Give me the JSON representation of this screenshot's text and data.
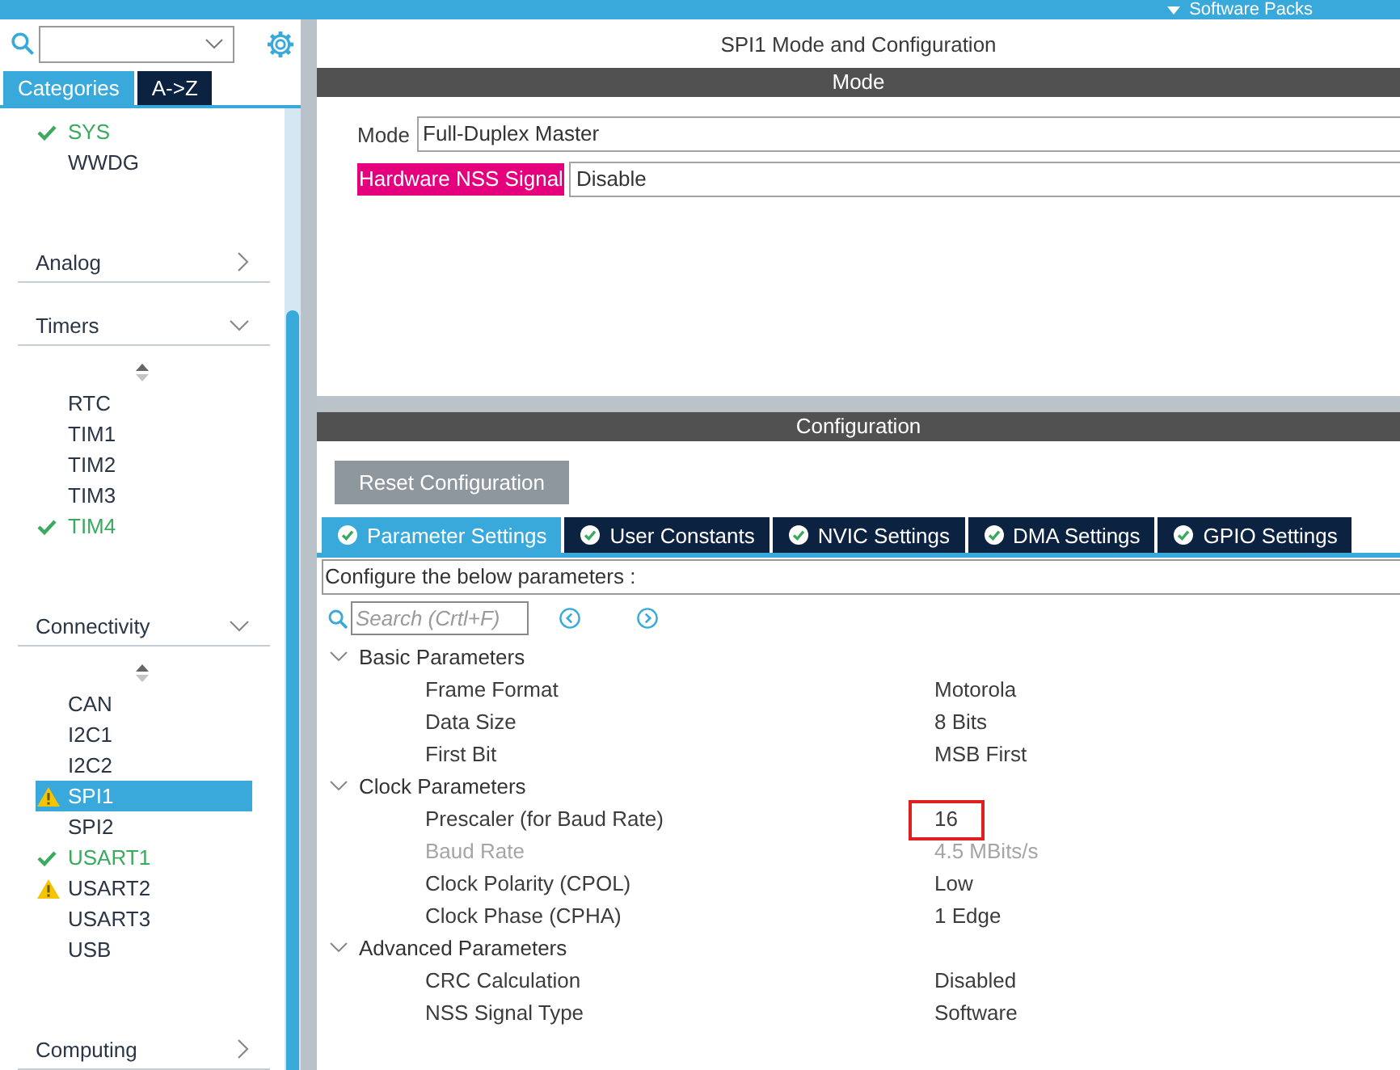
{
  "top_bar": {
    "menu_label": "Software Packs"
  },
  "sidebar": {
    "tabs": [
      {
        "label": "Categories",
        "selected": true
      },
      {
        "label": "A->Z",
        "selected": false
      }
    ],
    "leading_items": [
      {
        "label": "SYS",
        "configured": true,
        "warning": false,
        "selected": false
      },
      {
        "label": "WWDG",
        "configured": false,
        "warning": false,
        "selected": false
      }
    ],
    "categories": [
      {
        "name": "Analog",
        "expanded": false
      },
      {
        "name": "Timers",
        "expanded": true,
        "items": [
          {
            "label": "RTC",
            "configured": false,
            "warning": false,
            "selected": false
          },
          {
            "label": "TIM1",
            "configured": false,
            "warning": false,
            "selected": false
          },
          {
            "label": "TIM2",
            "configured": false,
            "warning": false,
            "selected": false
          },
          {
            "label": "TIM3",
            "configured": false,
            "warning": false,
            "selected": false
          },
          {
            "label": "TIM4",
            "configured": true,
            "warning": false,
            "selected": false
          }
        ]
      },
      {
        "name": "Connectivity",
        "expanded": true,
        "items": [
          {
            "label": "CAN",
            "configured": false,
            "warning": false,
            "selected": false
          },
          {
            "label": "I2C1",
            "configured": false,
            "warning": false,
            "selected": false
          },
          {
            "label": "I2C2",
            "configured": false,
            "warning": false,
            "selected": false
          },
          {
            "label": "SPI1",
            "configured": false,
            "warning": true,
            "selected": true
          },
          {
            "label": "SPI2",
            "configured": false,
            "warning": false,
            "selected": false
          },
          {
            "label": "USART1",
            "configured": true,
            "warning": false,
            "selected": false
          },
          {
            "label": "USART2",
            "configured": false,
            "warning": true,
            "selected": false
          },
          {
            "label": "USART3",
            "configured": false,
            "warning": false,
            "selected": false
          },
          {
            "label": "USB",
            "configured": false,
            "warning": false,
            "selected": false
          }
        ]
      },
      {
        "name": "Computing",
        "expanded": false
      }
    ]
  },
  "main": {
    "title": "SPI1 Mode and Configuration",
    "mode_section": {
      "header": "Mode",
      "fields": [
        {
          "label": "Mode",
          "value": "Full-Duplex Master",
          "highlighted": false
        },
        {
          "label": "Hardware NSS Signal",
          "value": "Disable",
          "highlighted": true
        }
      ]
    },
    "config_section": {
      "header": "Configuration",
      "reset_button": "Reset Configuration",
      "tabs": [
        {
          "label": "Parameter Settings",
          "selected": true
        },
        {
          "label": "User Constants",
          "selected": false
        },
        {
          "label": "NVIC Settings",
          "selected": false
        },
        {
          "label": "DMA Settings",
          "selected": false
        },
        {
          "label": "GPIO Settings",
          "selected": false
        }
      ],
      "hint": "Configure the below parameters :",
      "search": {
        "placeholder": "Search (Crtl+F)"
      },
      "parameter_groups": [
        {
          "name": "Basic Parameters",
          "expanded": true,
          "parameters": [
            {
              "label": "Frame Format",
              "value": "Motorola",
              "disabled": false,
              "framed": false
            },
            {
              "label": "Data Size",
              "value": "8 Bits",
              "disabled": false,
              "framed": false
            },
            {
              "label": "First Bit",
              "value": "MSB First",
              "disabled": false,
              "framed": false
            }
          ]
        },
        {
          "name": "Clock Parameters",
          "expanded": true,
          "parameters": [
            {
              "label": "Prescaler (for Baud Rate)",
              "value": "16",
              "disabled": false,
              "framed": true
            },
            {
              "label": "Baud Rate",
              "value": "4.5 MBits/s",
              "disabled": true,
              "framed": false
            },
            {
              "label": "Clock Polarity (CPOL)",
              "value": "Low",
              "disabled": false,
              "framed": false
            },
            {
              "label": "Clock Phase (CPHA)",
              "value": "1 Edge",
              "disabled": false,
              "framed": false
            }
          ]
        },
        {
          "name": "Advanced Parameters",
          "expanded": true,
          "parameters": [
            {
              "label": "CRC Calculation",
              "value": "Disabled",
              "disabled": false,
              "framed": false
            },
            {
              "label": "NSS Signal Type",
              "value": "Software",
              "disabled": false,
              "framed": false
            }
          ]
        }
      ]
    }
  }
}
